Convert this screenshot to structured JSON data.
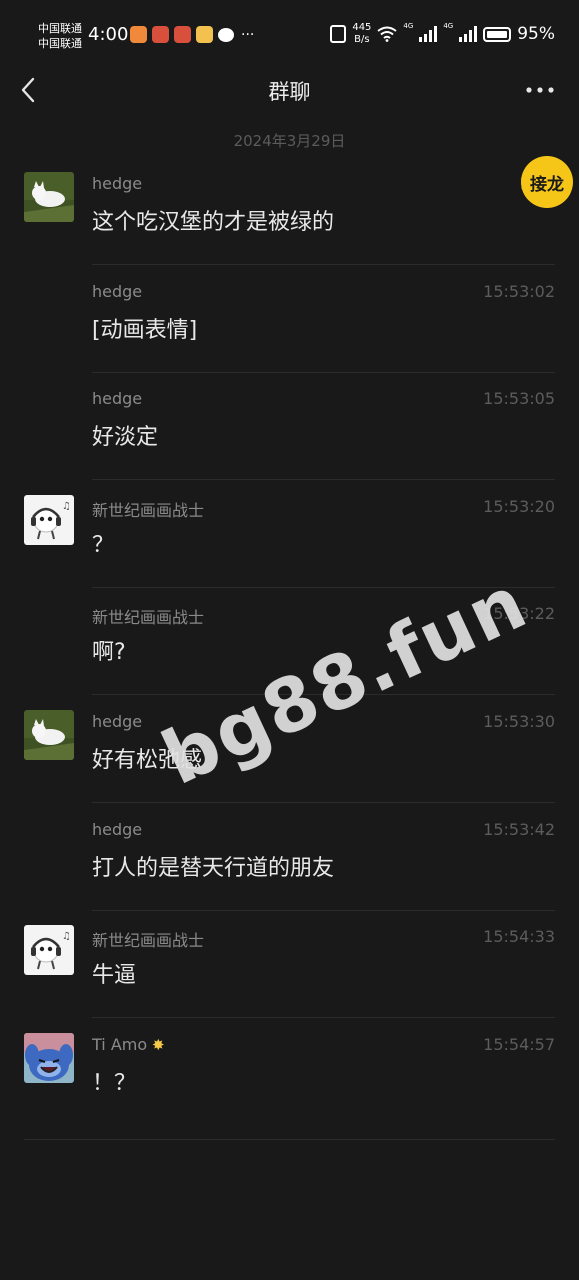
{
  "status_bar": {
    "carrier_1": "中国联通",
    "carrier_2": "中国联通",
    "time": "4:00",
    "net_speed_value": "445",
    "net_speed_unit": "B/s",
    "net_1": "4G",
    "net_2": "4G",
    "battery": "95%"
  },
  "nav": {
    "title": "群聊"
  },
  "date_separator": "2024年3月29日",
  "float_button": "接龙",
  "messages": [
    {
      "sender": "hedge",
      "time": "15:5",
      "text": "这个吃汉堡的才是被绿的",
      "avatar": "hedge"
    },
    {
      "sender": "hedge",
      "time": "15:53:02",
      "text": "[动画表情]",
      "avatar": ""
    },
    {
      "sender": "hedge",
      "time": "15:53:05",
      "text": "好淡定",
      "avatar": ""
    },
    {
      "sender": "新世纪画画战士",
      "time": "15:53:20",
      "text": "？",
      "avatar": "warrior"
    },
    {
      "sender": "新世纪画画战士",
      "time": "15:53:22",
      "text": "啊?",
      "avatar": ""
    },
    {
      "sender": "hedge",
      "time": "15:53:30",
      "text": "好有松弛感",
      "avatar": "hedge"
    },
    {
      "sender": "hedge",
      "time": "15:53:42",
      "text": "打人的是替天行道的朋友",
      "avatar": ""
    },
    {
      "sender": "新世纪画画战士",
      "time": "15:54:33",
      "text": "牛逼",
      "avatar": "warrior"
    },
    {
      "sender": "Ti Amo",
      "time": "15:54:57",
      "text": "！？",
      "avatar": "stitch"
    }
  ],
  "watermark": "bg88.fun",
  "colors": {
    "background": "#191919",
    "sender": "#8a8a8a",
    "time": "#5c5c5c",
    "float_button": "#f5c518"
  }
}
